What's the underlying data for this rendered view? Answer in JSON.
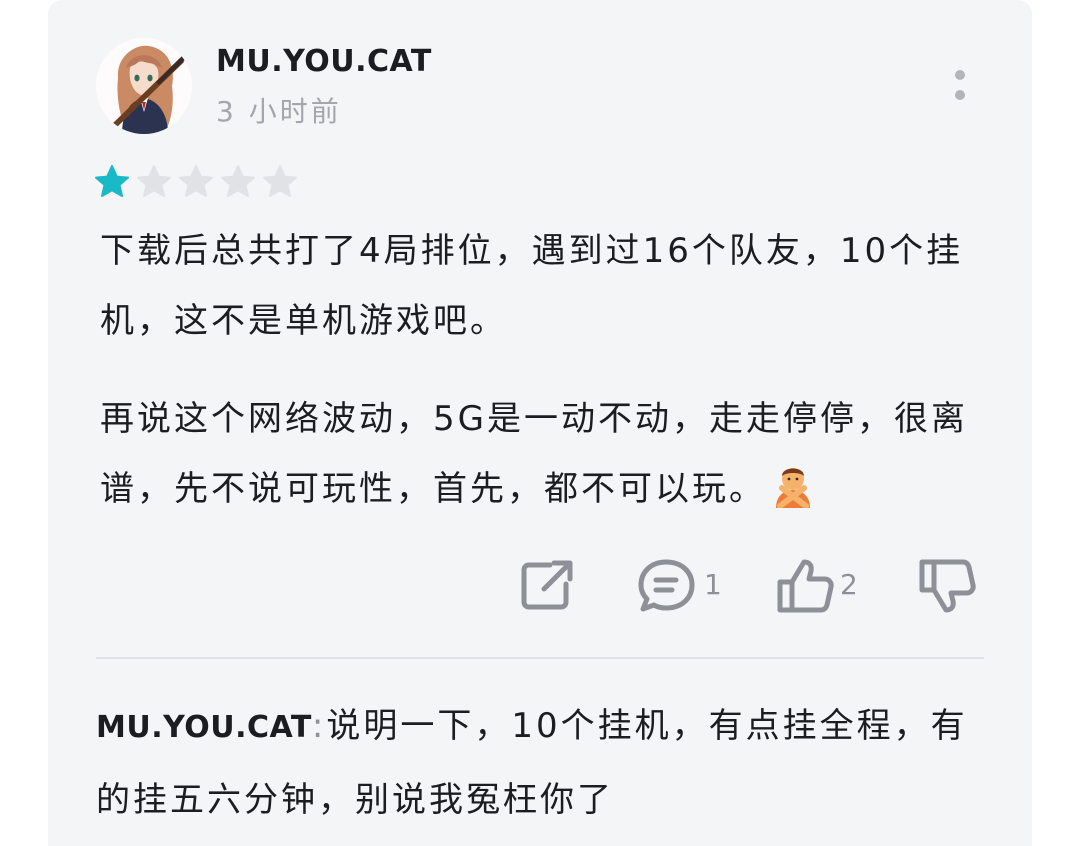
{
  "review": {
    "username": "MU.YOU.CAT",
    "time_ago": "3 小时前",
    "rating": {
      "value": 1,
      "max": 5,
      "filled_color": "#19b9c8",
      "empty_color": "#e0e2e5"
    },
    "paragraphs": [
      "下载后总共打了4局排位，遇到过16个队友，10个挂机，这不是单机游戏吧。",
      "再说这个网络波动，5G是一动不动，走走停停，很离谱，先不说可玩性，首先，都不可以玩。"
    ],
    "trailing_emoji": "person-gesturing-no-emoji",
    "actions": {
      "share_icon": "share-icon",
      "comment_icon": "comment-icon",
      "comment_count": "1",
      "like_icon": "thumbs-up-icon",
      "like_count": "2",
      "dislike_icon": "thumbs-down-icon"
    }
  },
  "reply": {
    "author": "MU.YOU.CAT",
    "separator": ":",
    "text": "说明一下，10个挂机，有点挂全程，有的挂五六分钟，别说我冤枉你了"
  },
  "colors": {
    "card_background": "#f4f5f7",
    "icon_gray": "#8d9197",
    "text": "#1b1d21",
    "muted_text": "#a3a7ad"
  }
}
